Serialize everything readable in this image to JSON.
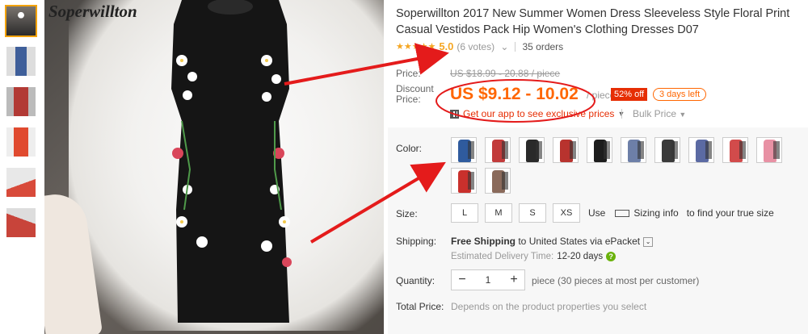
{
  "brand": "Soperwillton",
  "product": {
    "title": "Soperwillton 2017 New Summer Women Dress Sleeveless Style Floral Print Casual Vestidos Pack Hip Women's Clothing Dresses D07",
    "rating": "5.0",
    "votes": "(6 votes)",
    "orders": "35 orders"
  },
  "price": {
    "label": "Price:",
    "original": "US $18.99 - 20.88 / piece",
    "discount_label": "Discount\nPrice:",
    "discount": "US $9.12 - 10.02",
    "unit": "/ piece",
    "off_badge": "52% off",
    "days_left": "3 days left",
    "app_promo": "Get our app to see exclusive prices",
    "bulk": "Bulk Price"
  },
  "options": {
    "color_label": "Color:",
    "size_label": "Size:",
    "sizes": [
      "L",
      "M",
      "S",
      "XS"
    ],
    "size_use": "Use",
    "sizing_info": "Sizing info",
    "size_find": "to find your true size",
    "shipping_label": "Shipping:",
    "shipping_free": "Free Shipping",
    "shipping_to": " to ",
    "shipping_dest": "United States via ePacket",
    "delivery_label": "Estimated Delivery Time:",
    "delivery_value": "12-20 days",
    "quantity_label": "Quantity:",
    "quantity_value": "1",
    "quantity_note": "piece (30 pieces at most per customer)",
    "total_label": "Total Price:",
    "total_note": "Depends on the product properties you select"
  },
  "colors": {
    "accent": "#ff6600",
    "badge": "#e62e04",
    "star": "#f5a623",
    "thumb_active": "#f3a30c"
  },
  "swatch_colors": [
    "#2f5b9e",
    "#c23b3b",
    "#2a2a2a",
    "#b8332e",
    "#1d1d1d",
    "#6d7fa8",
    "#3a3a3a",
    "#5b6aa3",
    "#d24b4b",
    "#e891a4",
    "#c9302c",
    "#8a6a5b"
  ]
}
